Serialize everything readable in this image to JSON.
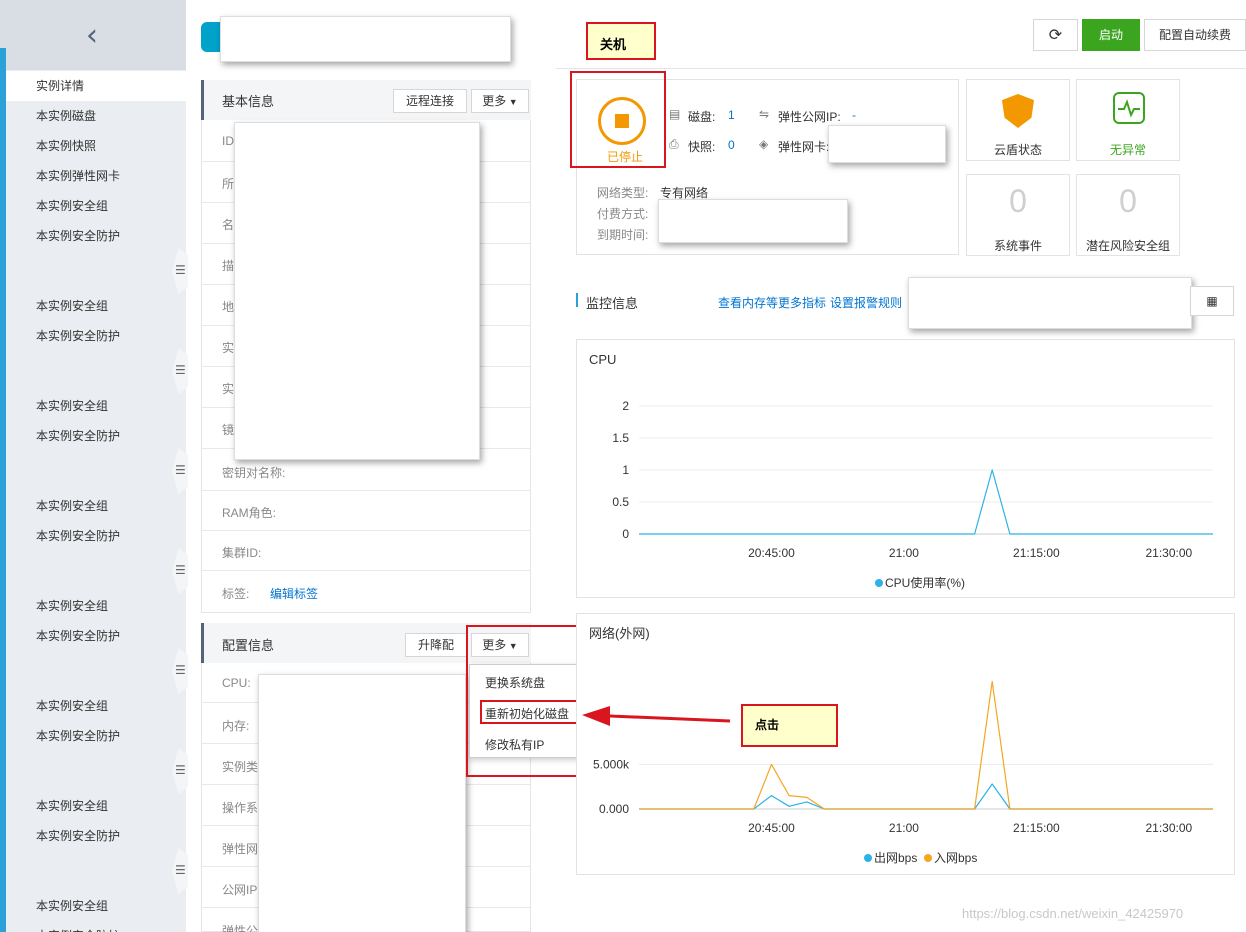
{
  "sidebar": {
    "back_glyph": "‹",
    "items": [
      "实例详情",
      "本实例磁盘",
      "本实例快照",
      "本实例弹性网卡",
      "本实例安全组",
      "本实例安全防护",
      "本实例安全组",
      "本实例安全防护",
      "本实例安全组",
      "本实例安全防护",
      "本实例安全组",
      "本实例安全防护",
      "本实例安全组",
      "本实例安全防护",
      "本实例安全组",
      "本实例安全防护",
      "本实例安全组",
      "本实例安全防护",
      "本实例安全组",
      "本实例安全防护"
    ],
    "handle_glyph": "☰"
  },
  "header": {
    "shutdown_note": "关机",
    "refresh_icon": "refresh-icon",
    "refresh_glyph": "⟳",
    "start_label": "启动",
    "auto_renew_label": "配置自动续费"
  },
  "basic_info": {
    "title": "基本信息",
    "remote_connect": "远程连接",
    "more": "更多",
    "rows": [
      {
        "label": "ID"
      },
      {
        "label": "所"
      },
      {
        "label": "名"
      },
      {
        "label": "描"
      },
      {
        "label": "地"
      },
      {
        "label": "实"
      },
      {
        "label": "实"
      },
      {
        "label": "镜"
      }
    ],
    "key_pair": "密钥对名称:",
    "ram_role": "RAM角色:",
    "cluster_id": "集群ID:",
    "tags_label": "标签:",
    "edit_tags": "编辑标签"
  },
  "config_info": {
    "title": "配置信息",
    "upgrade": "升降配",
    "more": "更多",
    "rows": [
      "CPU:",
      "内存:",
      "实例类",
      "操作系",
      "弹性网",
      "公网IP",
      "弹性公"
    ]
  },
  "more_menu": {
    "items": [
      "更换系统盘",
      "重新初始化磁盘",
      "修改私有IP"
    ]
  },
  "status": {
    "state": "已停止",
    "disk_label": "磁盘:",
    "disk_value": "1",
    "eip_label": "弹性公网IP:",
    "eip_value": "-",
    "snapshot_label": "快照:",
    "snapshot_value": "0",
    "eni_label": "弹性网卡:",
    "network_type_label": "网络类型:",
    "network_type_value": "专有网络",
    "billing_label": "付费方式:",
    "expire_label": "到期时间:"
  },
  "tiles": {
    "cloud_shield": "云盾状态",
    "no_anomaly": "无异常",
    "system_events_count": "0",
    "system_events": "系统事件",
    "risk_sg_count": "0",
    "risk_sg": "潜在风险安全组"
  },
  "monitor": {
    "title": "监控信息",
    "more_metrics": "查看内存等更多指标",
    "alert_rules": "设置报警规则",
    "calendar_glyph": "▦"
  },
  "annotation": {
    "click_note": "点击"
  },
  "watermark": "https://blog.csdn.net/weixin_42425970",
  "colors": {
    "accent": "#2aa1d9",
    "stopped": "#f39800",
    "ok": "#3ca51f",
    "annot": "#d9161d",
    "line_out": "#2bb3e8",
    "line_in": "#f5a623"
  },
  "chart_data": [
    {
      "type": "line",
      "title": "CPU",
      "x_ticks": [
        "20:45:00",
        "21:00",
        "21:15:00",
        "21:30:00"
      ],
      "y_ticks": [
        "0",
        "0.5",
        "1",
        "1.5",
        "2"
      ],
      "ylim": [
        0,
        2
      ],
      "series": [
        {
          "name": "CPU使用率(%)",
          "color": "#2bb3e8",
          "points": [
            [
              "20:30",
              0
            ],
            [
              "21:08",
              0
            ],
            [
              "21:10",
              1
            ],
            [
              "21:12",
              0
            ],
            [
              "21:35",
              0
            ]
          ]
        }
      ],
      "legend": "bottom"
    },
    {
      "type": "line",
      "title": "网络(外网)",
      "x_ticks": [
        "20:45:00",
        "21:00",
        "21:15:00",
        "21:30:00"
      ],
      "y_ticks": [
        "0.000",
        "5.000k"
      ],
      "ylim": [
        0,
        14000
      ],
      "series": [
        {
          "name": "出网bps",
          "color": "#2bb3e8",
          "points": [
            [
              "20:30",
              0
            ],
            [
              "20:43",
              0
            ],
            [
              "20:45",
              1500
            ],
            [
              "20:47",
              300
            ],
            [
              "20:49",
              800
            ],
            [
              "20:51",
              0
            ],
            [
              "21:08",
              0
            ],
            [
              "21:10",
              2800
            ],
            [
              "21:12",
              0
            ],
            [
              "21:35",
              0
            ]
          ]
        },
        {
          "name": "入网bps",
          "color": "#f5a623",
          "points": [
            [
              "20:30",
              0
            ],
            [
              "20:43",
              0
            ],
            [
              "20:45",
              5000
            ],
            [
              "20:47",
              1500
            ],
            [
              "20:49",
              1300
            ],
            [
              "20:51",
              0
            ],
            [
              "21:08",
              0
            ],
            [
              "21:10",
              14500
            ],
            [
              "21:12",
              0
            ],
            [
              "21:35",
              0
            ]
          ]
        }
      ],
      "legend": "bottom"
    }
  ]
}
